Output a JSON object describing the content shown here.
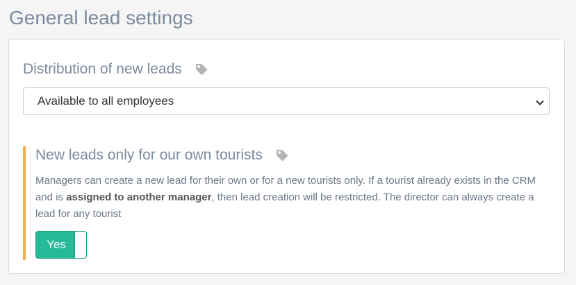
{
  "page": {
    "title": "General lead settings"
  },
  "distribution": {
    "title": "Distribution of new leads",
    "tag_icon": "tag-icon",
    "select": {
      "selected": "Available to all employees",
      "icon": "chevron-down-icon"
    }
  },
  "own_tourists": {
    "title": "New leads only for our own tourists",
    "tag_icon": "tag-icon",
    "description_before": "Managers can create a new lead for their own or for a new tourists only. If a tourist already exists in the CRM and is ",
    "description_bold": "assigned to another manager",
    "description_after": ", then lead creation will be restricted. The director can always create a lead for any tourist",
    "toggle": {
      "label": "Yes",
      "state": "on"
    }
  },
  "colors": {
    "title_text": "#7b8a9e",
    "accent_border": "#f0ad4e",
    "toggle_on": "#26b99a",
    "icon_gray": "#b5b5b5"
  }
}
